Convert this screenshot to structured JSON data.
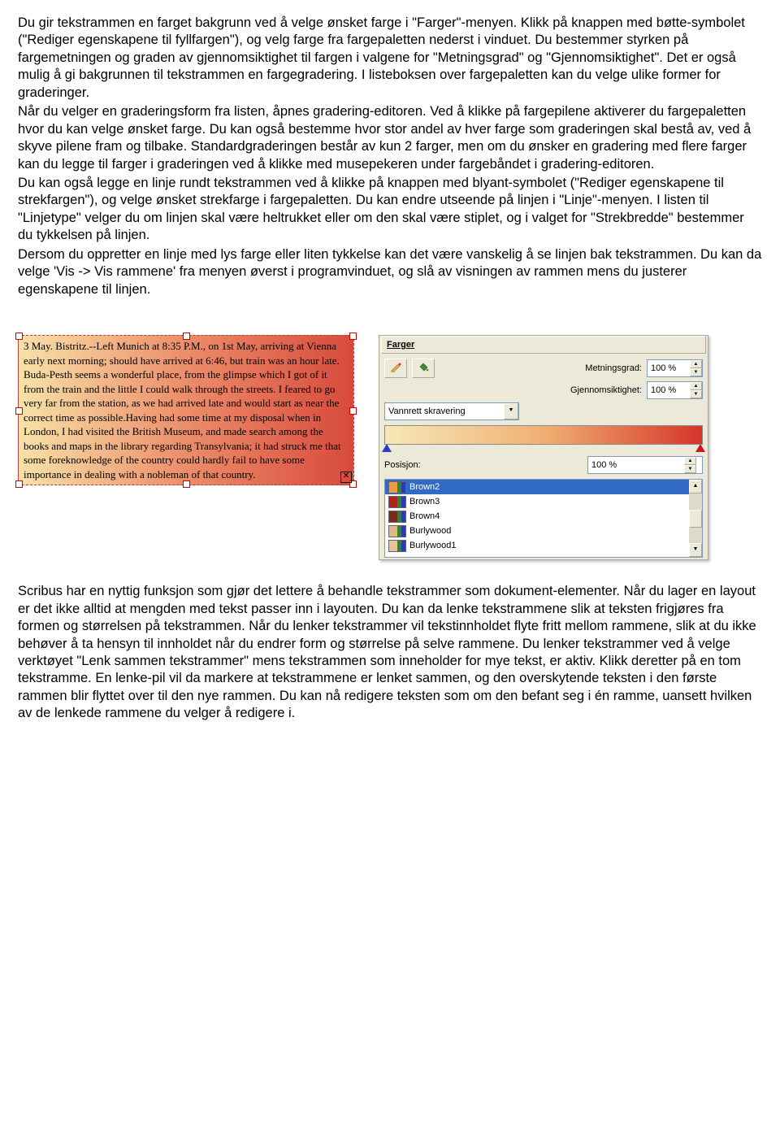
{
  "para1": "Du gir tekstrammen en farget bakgrunn ved å velge ønsket farge i \"Farger\"-menyen. Klikk på knappen med bøtte-symbolet (\"Rediger egenskapene til fyllfargen\"), og velg farge fra fargepaletten nederst i vinduet. Du bestemmer styrken på fargemetningen og graden av gjennomsiktighet til fargen i valgene for \"Metningsgrad\" og \"Gjennomsiktighet\". Det er også mulig å gi bakgrunnen til tekstrammen en fargegradering. I listeboksen over fargepaletten kan du velge ulike former for graderinger.",
  "para2": "Når du velger en graderingsform fra listen, åpnes gradering-editoren. Ved å klikke på fargepilene aktiverer du fargepaletten hvor du kan velge ønsket farge. Du kan også bestemme hvor stor andel av hver farge som graderingen skal bestå av, ved å skyve pilene fram og tilbake. Standardgraderingen består av kun 2 farger, men om du ønsker en gradering med flere farger kan du legge til farger i graderingen ved å klikke med musepekeren under fargebåndet i gradering-editoren.",
  "para3": "Du kan også legge en linje rundt tekstrammen ved å klikke på knappen med blyant-symbolet (\"Rediger egenskapene til strekfargen\"), og velge ønsket strekfarge i fargepaletten. Du kan endre utseende på linjen i \"Linje\"-menyen. I listen til \"Linjetype\" velger du om linjen skal være heltrukket eller om den skal være stiplet, og i valget for \"Strekbredde\" bestemmer du tykkelsen på linjen.",
  "para4": "Dersom du oppretter en linje med lys farge eller liten tykkelse kan det være vanskelig å se linjen bak tekstrammen. Du kan da velge 'Vis -> Vis rammene' fra menyen øverst i programvinduet, og slå av visningen av rammen mens du justerer egenskapene til linjen.",
  "sample_text": "3 May. Bistritz.--Left Munich at 8:35 P.M., on 1st May, arriving at Vienna early next morning; should have arrived at 6:46, but train was an hour late. Buda-Pesth seems a wonderful place, from the glimpse which I got of it from the train and the little I could walk through the streets. I feared to go very far from the station, as we had arrived late and would start as near the correct time as possible.Having had some time at my disposal when in London, I had visited the British Museum, and made search among the books and maps in the library regarding Transylvania; it had struck me that some foreknowledge of the country could hardly fail to have some importance in dealing with a nobleman of that country.",
  "panel": {
    "title": "Farger",
    "metning_label": "Metningsgrad:",
    "metning_value": "100 %",
    "gjennom_label": "Gjennomsiktighet:",
    "gjennom_value": "100 %",
    "dropdown_value": "Vannrett skravering",
    "position_label": "Posisjon:",
    "position_value": "100 %",
    "colors": [
      {
        "name": "Brown2",
        "hex": "#ee9a49"
      },
      {
        "name": "Brown3",
        "hex": "#b22222"
      },
      {
        "name": "Brown4",
        "hex": "#7a2b1d"
      },
      {
        "name": "Burlywood",
        "hex": "#deb887"
      },
      {
        "name": "Burlywood1",
        "hex": "#e6c49a"
      }
    ]
  },
  "para5": "Scribus har en nyttig funksjon som gjør det lettere å behandle tekstrammer som dokument-elementer. Når du lager en layout er det ikke alltid at mengden med tekst passer inn i layouten. Du kan da lenke tekstrammene slik at teksten frigjøres fra formen og størrelsen på tekstrammen. Når du lenker tekstrammer vil tekstinnholdet flyte fritt mellom rammene, slik at du ikke behøver å ta hensyn til innholdet når du endrer form og størrelse på selve rammene. Du lenker tekstrammer ved å velge verktøyet \"Lenk sammen tekstrammer\" mens tekstrammen som inneholder for mye tekst, er aktiv. Klikk deretter på en tom tekstramme. En lenke-pil vil da markere at tekstrammene er lenket sammen, og den overskytende teksten i den første rammen blir flyttet over til den nye rammen. Du kan nå redigere teksten som om den befant seg i én ramme, uansett hvilken av de lenkede rammene du velger å redigere i."
}
